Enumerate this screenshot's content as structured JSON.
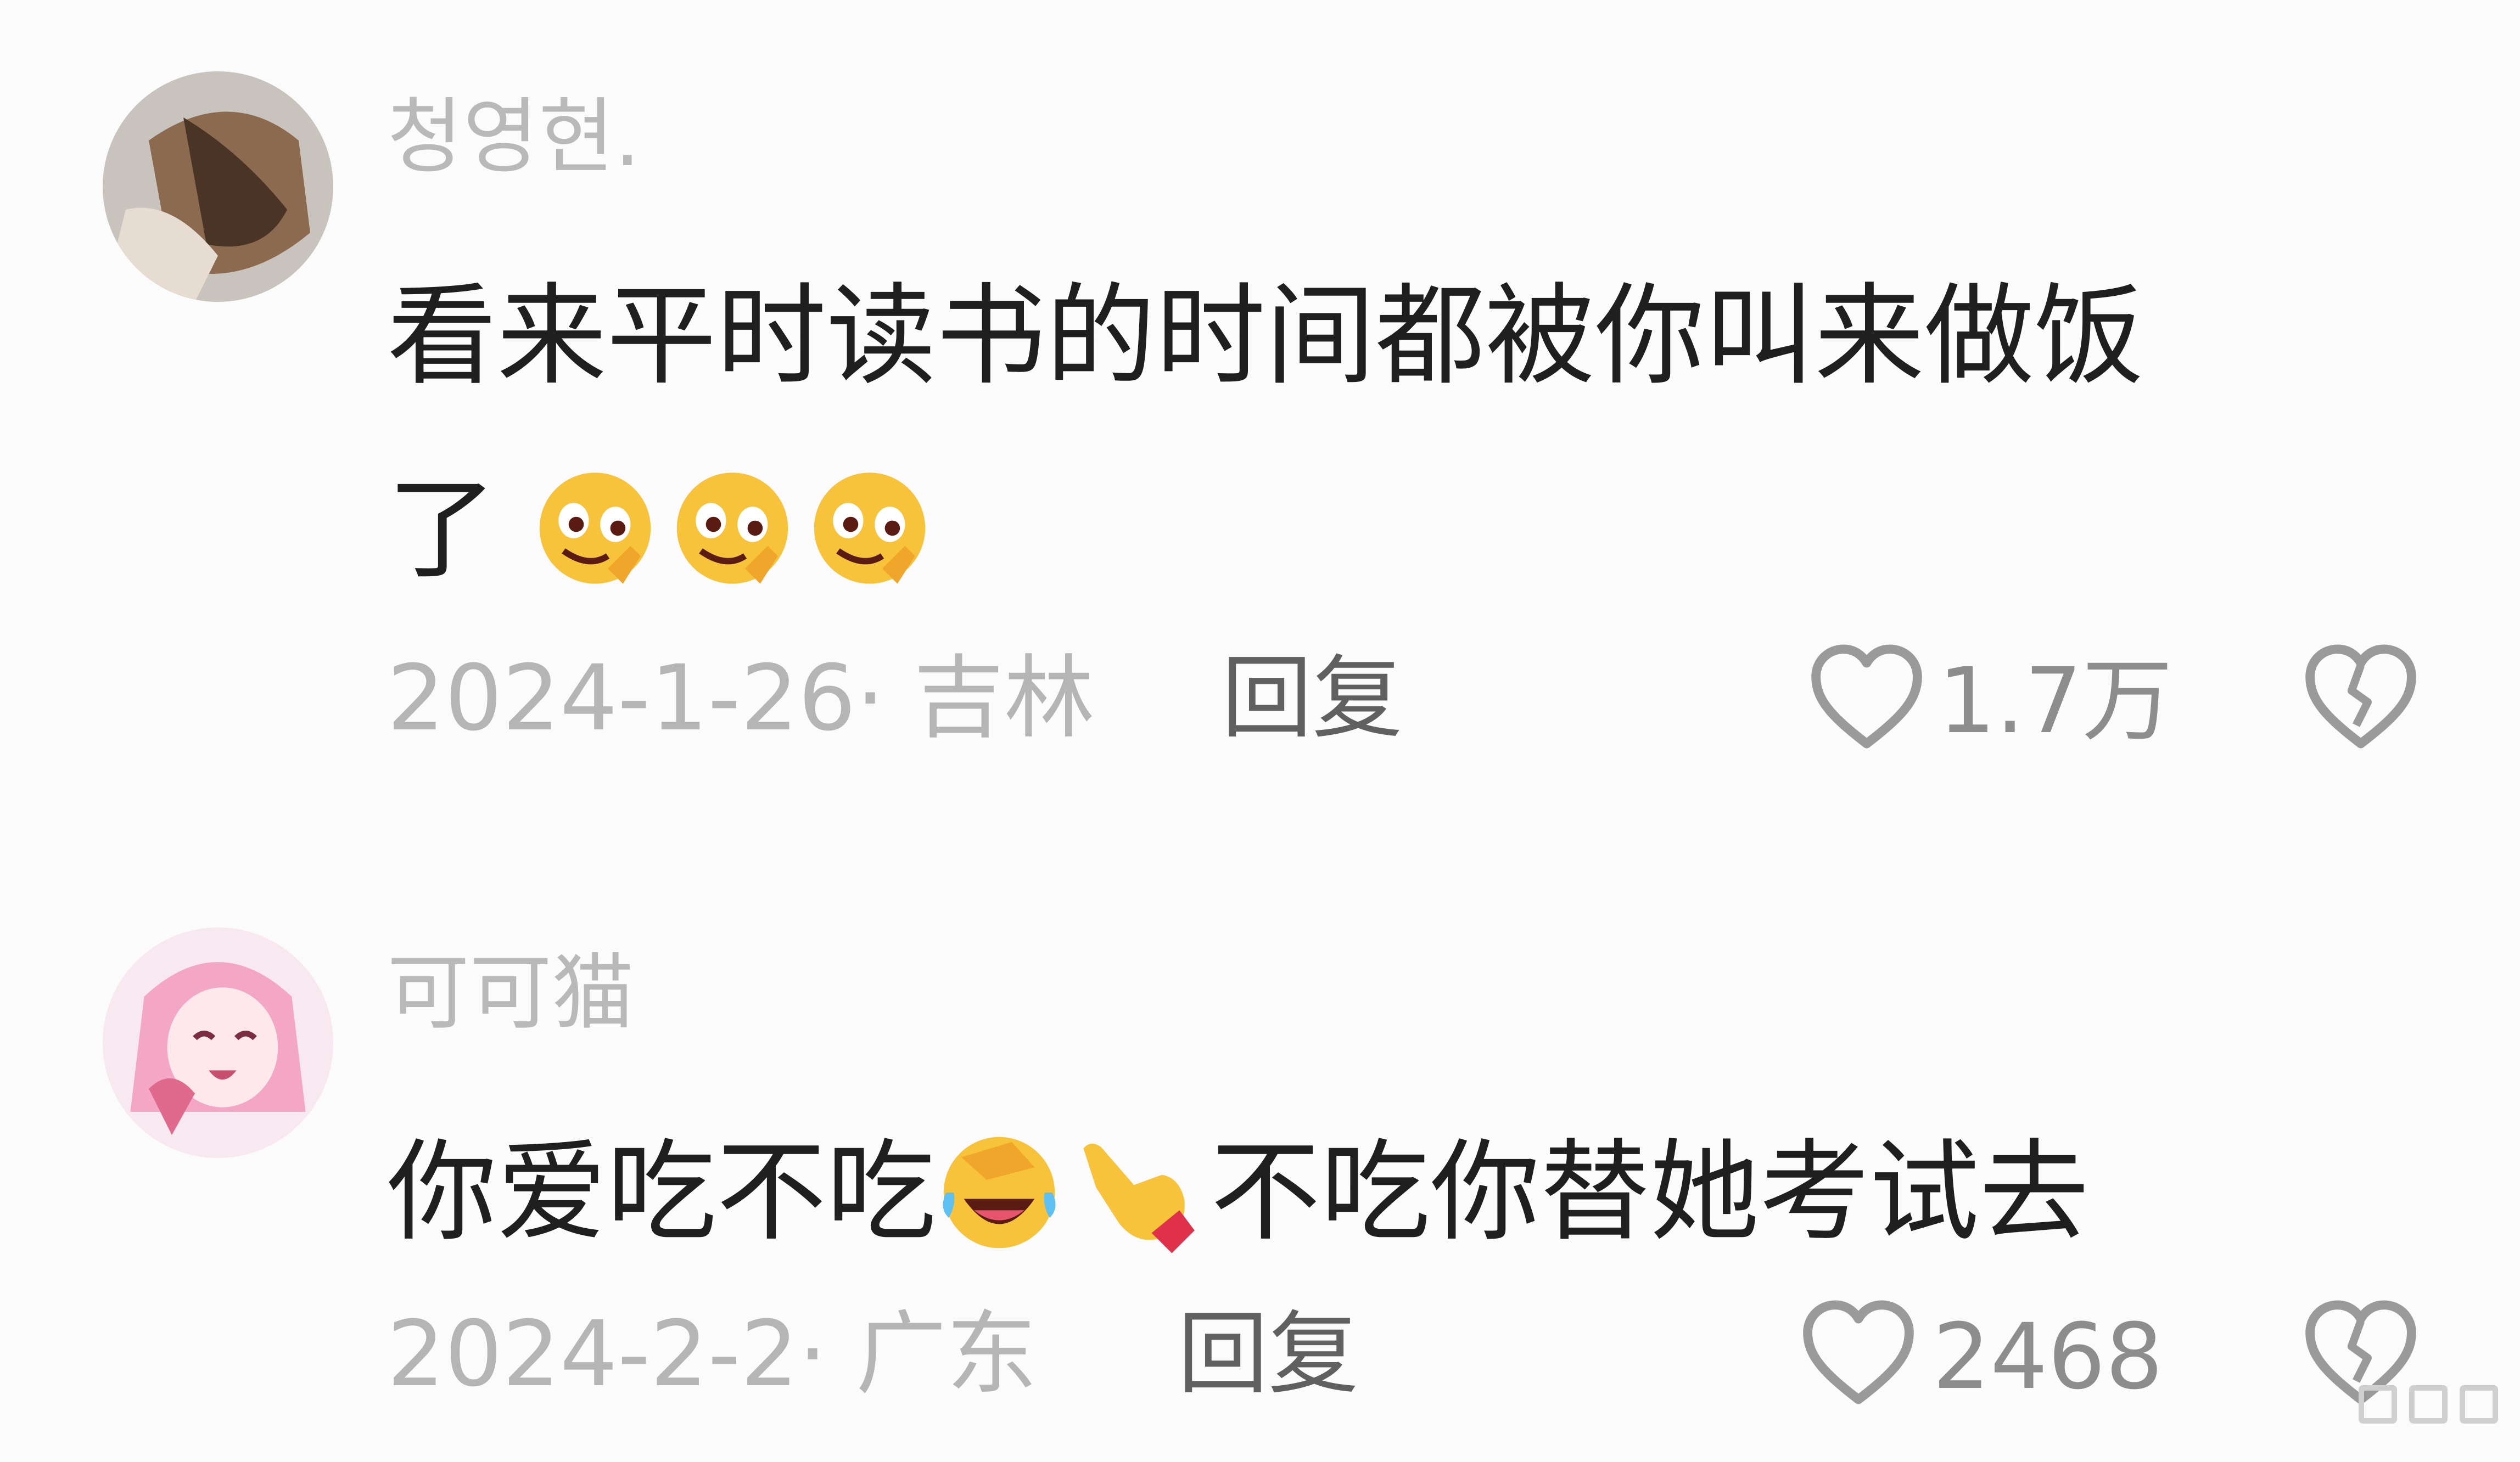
{
  "comments": [
    {
      "username": "청영현.",
      "text_line1": "看来平时读书的时间都被你叫来做饭",
      "text_line2": "了",
      "emojis": [
        "smirk-hand-emoji",
        "smirk-hand-emoji",
        "smirk-hand-emoji"
      ],
      "date_location": "2024-1-26· 吉林",
      "reply_label": "回复",
      "like_count": "1.7万",
      "icons": {
        "like": "heart-outline-icon",
        "dislike": "broken-heart-icon"
      }
    },
    {
      "username": "可可猫",
      "text_part1": "你爱吃不吃",
      "emojis": [
        "laugh-cry-emoji",
        "point-hand-emoji"
      ],
      "text_part2": "不吃你替她考试去",
      "date_location": "2024-2-2· 广东",
      "reply_label": "回复",
      "like_count": "2468",
      "icons": {
        "like": "heart-outline-icon",
        "dislike": "broken-heart-icon"
      }
    }
  ],
  "colors": {
    "background": "#fbfbfb",
    "body_text": "#1f1f1f",
    "muted_text": "#b5b5b5",
    "reply_text": "#606060",
    "emoji_yellow": "#f7c33a"
  }
}
